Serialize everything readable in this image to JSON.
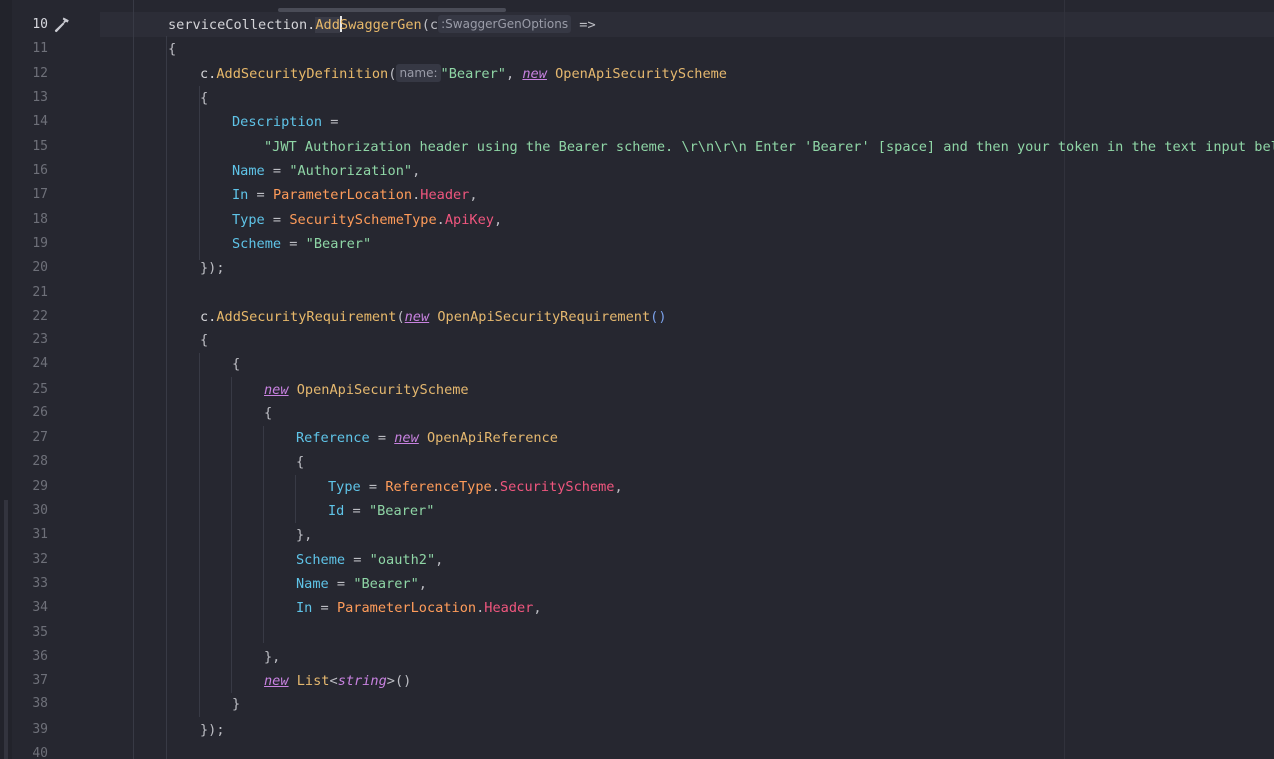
{
  "editor": {
    "lines": [
      {
        "n": "10",
        "current": true
      },
      {
        "n": "11"
      },
      {
        "n": "12"
      },
      {
        "n": "13"
      },
      {
        "n": "14"
      },
      {
        "n": "15"
      },
      {
        "n": "16"
      },
      {
        "n": "17"
      },
      {
        "n": "18"
      },
      {
        "n": "19"
      },
      {
        "n": "20"
      },
      {
        "n": "21"
      },
      {
        "n": "22"
      },
      {
        "n": "23"
      },
      {
        "n": "24"
      },
      {
        "n": "25"
      },
      {
        "n": "26"
      },
      {
        "n": "27"
      },
      {
        "n": "28"
      },
      {
        "n": "29"
      },
      {
        "n": "30"
      },
      {
        "n": "31"
      },
      {
        "n": "32"
      },
      {
        "n": "33"
      },
      {
        "n": "34"
      },
      {
        "n": "35"
      },
      {
        "n": "36"
      },
      {
        "n": "37"
      },
      {
        "n": "38"
      },
      {
        "n": "39"
      },
      {
        "n": "40"
      }
    ],
    "gutter_icon": "hammer-icon",
    "code": {
      "l10_a": "serviceCollection.",
      "l10_b": "Add",
      "l10_c": "SwaggerGen",
      "l10_d": "(c",
      "l10_hint": ":SwaggerGenOptions",
      "l10_e": " =>",
      "l11": "{",
      "l12_a": "c.",
      "l12_b": "AddSecurityDefinition",
      "l12_c": "(",
      "l12_hint": "name:",
      "l12_d": "\"Bearer\"",
      "l12_e": ", ",
      "l12_kw": "new",
      "l12_type": "OpenApiSecurityScheme",
      "l13": "{",
      "l14_prop": "Description",
      "l14_op": " =",
      "l15": "\"JWT Authorization header using the Bearer scheme. \\r\\n\\r\\n Enter 'Bearer' [space] and then your token in the text input below",
      "l16_prop": "Name",
      "l16_op": " = ",
      "l16_str": "\"Authorization\"",
      "l16_end": ",",
      "l17_prop": "In",
      "l17_op": " = ",
      "l17_enum": "ParameterLocation",
      "l17_dot": ".",
      "l17_member": "Header",
      "l17_end": ",",
      "l18_prop": "Type",
      "l18_op": " = ",
      "l18_enum": "SecuritySchemeType",
      "l18_dot": ".",
      "l18_member": "ApiKey",
      "l18_end": ",",
      "l19_prop": "Scheme",
      "l19_op": " = ",
      "l19_str": "\"Bearer\"",
      "l20": "});",
      "l22_a": "c.",
      "l22_b": "AddSecurityRequirement",
      "l22_c": "(",
      "l22_kw": "new",
      "l22_type": "OpenApiSecurityRequirement",
      "l22_d": "()",
      "l23": "{",
      "l24": "{",
      "l25_kw": "new",
      "l25_type": "OpenApiSecurityScheme",
      "l26": "{",
      "l27_prop": "Reference",
      "l27_op": " = ",
      "l27_kw": "new",
      "l27_type": "OpenApiReference",
      "l28": "{",
      "l29_prop": "Type",
      "l29_op": " = ",
      "l29_enum": "ReferenceType",
      "l29_dot": ".",
      "l29_member": "SecurityScheme",
      "l29_end": ",",
      "l30_prop": "Id",
      "l30_op": " = ",
      "l30_str": "\"Bearer\"",
      "l31": "},",
      "l32_prop": "Scheme",
      "l32_op": " = ",
      "l32_str": "\"oauth2\"",
      "l32_end": ",",
      "l33_prop": "Name",
      "l33_op": " = ",
      "l33_str": "\"Bearer\"",
      "l33_end": ",",
      "l34_prop": "In",
      "l34_op": " = ",
      "l34_enum": "ParameterLocation",
      "l34_dot": ".",
      "l34_member": "Header",
      "l34_end": ",",
      "l36": "},",
      "l37_kw": "new",
      "l37_type": "List",
      "l37_lt": "<",
      "l37_generic": "string",
      "l37_gt": ">()",
      "l38": "}",
      "l39": "});"
    }
  },
  "colors": {
    "background": "#262730",
    "string": "#8fd6a6",
    "keyword": "#c882e0",
    "type": "#e5b86f",
    "property": "#5fc4e8",
    "enum": "#ff9c5a",
    "enum_member": "#f0567e"
  }
}
